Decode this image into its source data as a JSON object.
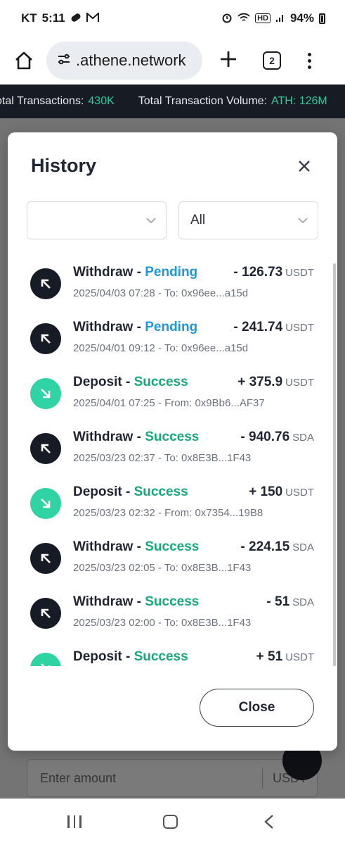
{
  "status_bar": {
    "carrier": "KT",
    "time": "5:11",
    "network_badge": "HD",
    "battery": "94%"
  },
  "browser": {
    "url": ".athene.network",
    "tab_count": "2"
  },
  "ticker": {
    "items": [
      {
        "label": "Total Transactions:",
        "value": "430K"
      },
      {
        "label": "Total Transaction Volume:",
        "value": "ATH: 126M"
      }
    ]
  },
  "modal": {
    "title": "History",
    "date_filter_value": "",
    "type_filter_value": "All",
    "close_label": "Close",
    "transactions": [
      {
        "type": "Withdraw",
        "status": "Pending",
        "amount": "- 126.73",
        "unit": "USDT",
        "date": "2025/04/03 07:28",
        "party_label": "To:",
        "address": "0x96ee...a15d"
      },
      {
        "type": "Withdraw",
        "status": "Pending",
        "amount": "- 241.74",
        "unit": "USDT",
        "date": "2025/04/01 09:12",
        "party_label": "To:",
        "address": "0x96ee...a15d"
      },
      {
        "type": "Deposit",
        "status": "Success",
        "amount": "+ 375.9",
        "unit": "USDT",
        "date": "2025/04/01 07:25",
        "party_label": "From:",
        "address": "0x9Bb6...AF37"
      },
      {
        "type": "Withdraw",
        "status": "Success",
        "amount": "- 940.76",
        "unit": "SDA",
        "date": "2025/03/23 02:37",
        "party_label": "To:",
        "address": "0x8E3B...1F43"
      },
      {
        "type": "Deposit",
        "status": "Success",
        "amount": "+ 150",
        "unit": "USDT",
        "date": "2025/03/23 02:32",
        "party_label": "From:",
        "address": "0x7354...19B8"
      },
      {
        "type": "Withdraw",
        "status": "Success",
        "amount": "- 224.15",
        "unit": "SDA",
        "date": "2025/03/23 02:05",
        "party_label": "To:",
        "address": "0x8E3B...1F43"
      },
      {
        "type": "Withdraw",
        "status": "Success",
        "amount": "- 51",
        "unit": "SDA",
        "date": "2025/03/23 02:00",
        "party_label": "To:",
        "address": "0x8E3B...1F43"
      },
      {
        "type": "Deposit",
        "status": "Success",
        "amount": "+ 51",
        "unit": "USDT",
        "date": "",
        "party_label": "",
        "address": ""
      }
    ]
  },
  "page": {
    "amount_placeholder": "Enter amount",
    "amount_unit": "USDT"
  },
  "colors": {
    "ticker_bg": "#171b24",
    "ticker_value": "#2ec79c",
    "pending": "#1e98d9",
    "success": "#18a97a",
    "withdraw_icon_bg": "#161b26",
    "deposit_icon_bg": "#2fd3a4"
  }
}
